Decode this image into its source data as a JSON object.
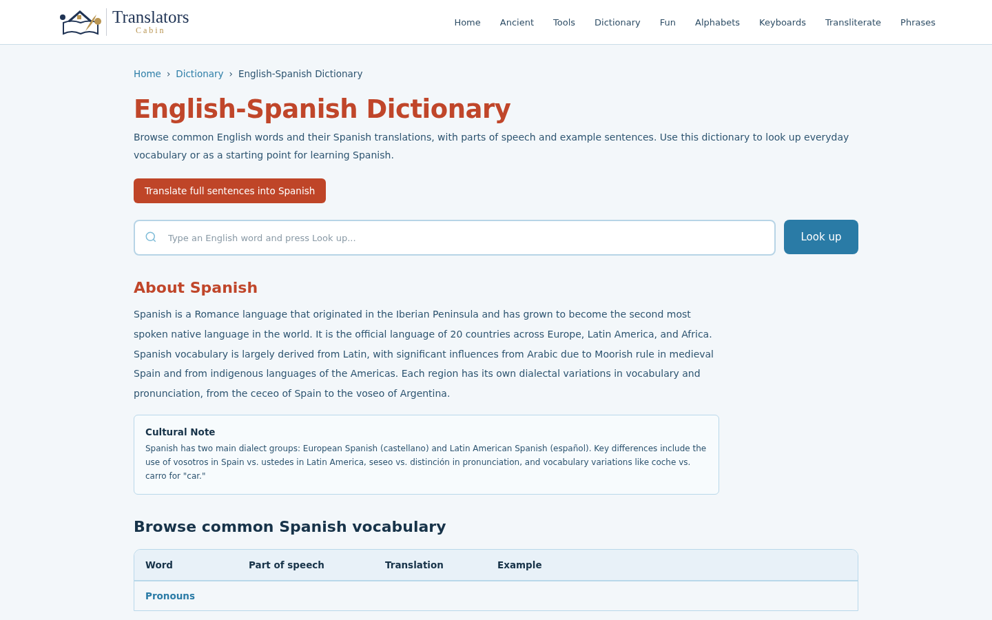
{
  "header": {
    "logo": {
      "title": "Translators",
      "subtitle": "Cabin"
    },
    "nav": [
      "Home",
      "Ancient",
      "Tools",
      "Dictionary",
      "Fun",
      "Alphabets",
      "Keyboards",
      "Transliterate",
      "Phrases"
    ]
  },
  "breadcrumb": {
    "links": [
      "Home",
      "Dictionary"
    ],
    "separator": "›",
    "current": "English-Spanish Dictionary"
  },
  "title": "English-Spanish Dictionary",
  "intro": "Browse common English words and their Spanish translations, with parts of speech and example sentences. Use this dictionary to look up everyday vocabulary or as a starting point for learning Spanish.",
  "cta_button": "Translate full sentences into Spanish",
  "search": {
    "placeholder": "Type an English word and press Look up...",
    "button": "Look up"
  },
  "about": {
    "heading": "About Spanish",
    "text": "Spanish is a Romance language that originated in the Iberian Peninsula and has grown to become the second most spoken native language in the world. It is the official language of 20 countries across Europe, Latin America, and Africa. Spanish vocabulary is largely derived from Latin, with significant influences from Arabic due to Moorish rule in medieval Spain and from indigenous languages of the Americas. Each region has its own dialectal variations in vocabulary and pronunciation, from the ceceo of Spain to the voseo of Argentina."
  },
  "note": {
    "title": "Cultural Note",
    "text": "Spanish has two main dialect groups: European Spanish (castellano) and Latin American Spanish (español). Key differences include the use of vosotros in Spain vs. ustedes in Latin America, seseo vs. distinción in pronunciation, and vocabulary variations like coche vs. carro for \"car.\""
  },
  "vocabulary": {
    "heading": "Browse common Spanish vocabulary",
    "table": {
      "columns": [
        "Word",
        "Part of speech",
        "Translation",
        "Example"
      ],
      "rows": [
        {
          "kind": "group",
          "label": "Pronouns"
        }
      ]
    }
  }
}
